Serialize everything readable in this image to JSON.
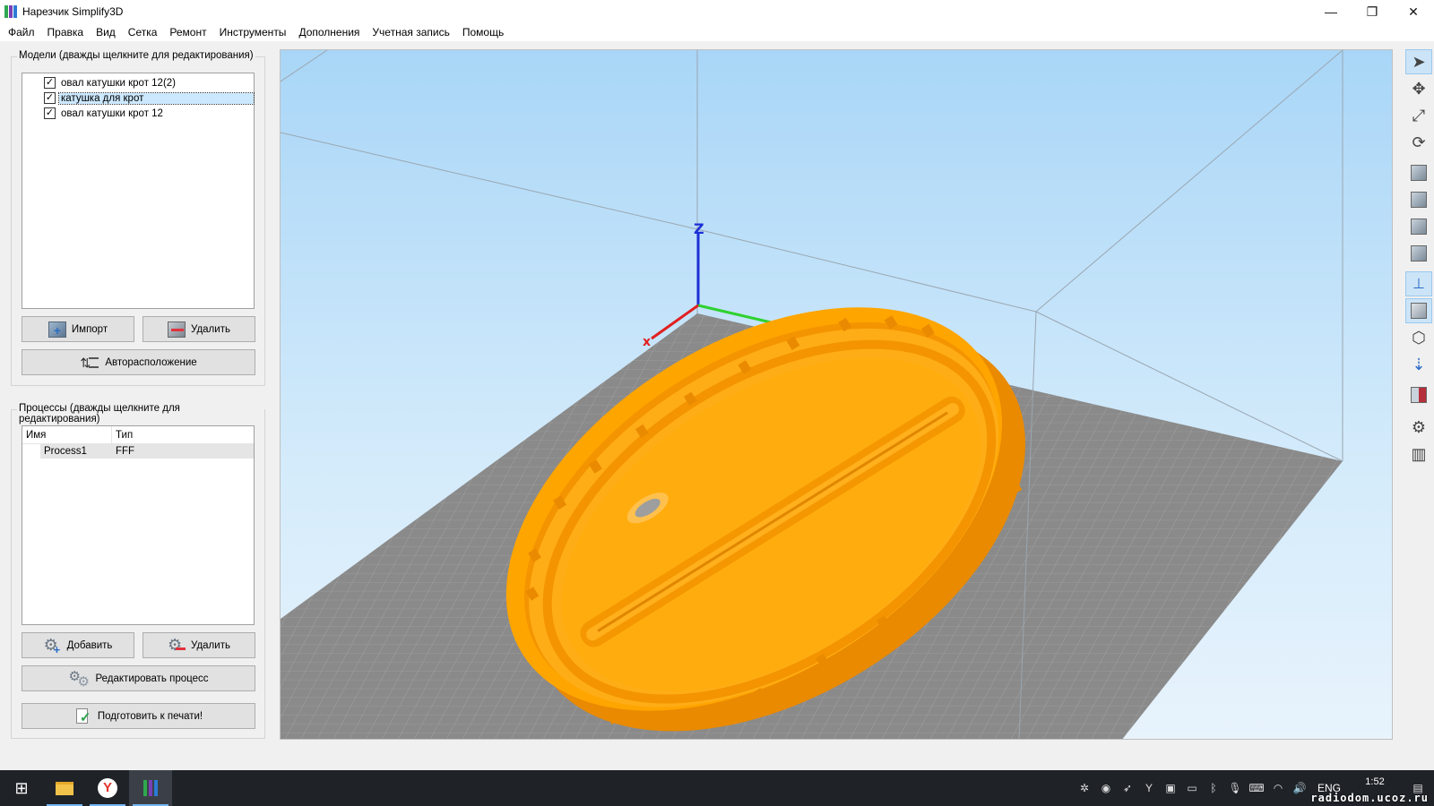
{
  "window": {
    "title": "Нарезчик Simplify3D",
    "controls": {
      "minimize": "—",
      "restore": "❐",
      "close": "✕"
    }
  },
  "menu": [
    "Файл",
    "Правка",
    "Вид",
    "Сетка",
    "Ремонт",
    "Инструменты",
    "Дополнения",
    "Учетная запись",
    "Помощь"
  ],
  "models": {
    "title": "Модели (дважды щелкните для редактирования)",
    "items": [
      {
        "label": "овал катушки крот 12(2)",
        "checked": true,
        "selected": false
      },
      {
        "label": "катушка для крот",
        "checked": true,
        "selected": true
      },
      {
        "label": "овал катушки крот 12",
        "checked": true,
        "selected": false
      }
    ],
    "import_label": "Импорт",
    "remove_label": "Удалить",
    "autoarrange_label": "Авторасположение"
  },
  "processes": {
    "title": "Процессы (дважды щелкните для редактирования)",
    "col_name": "Имя",
    "col_type": "Тип",
    "rows": [
      {
        "name": "Process1",
        "type": "FFF"
      }
    ],
    "add_label": "Добавить",
    "remove_label": "Удалить",
    "edit_label": "Редактировать процесс",
    "prepare_label": "Подготовить к печати!"
  },
  "taskbar": {
    "lang": "ENG",
    "time": "1:52",
    "watermark": "radiodom.ucoz.ru"
  },
  "colors": {
    "model": "#ffa500",
    "model_dark": "#e98a00",
    "sky_top": "#b7dcf8",
    "bed": "#8c8c8c"
  }
}
